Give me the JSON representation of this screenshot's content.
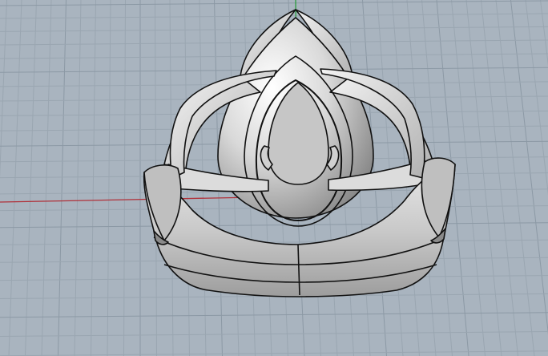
{
  "viewport": {
    "background": "#a9b4bf",
    "grid_minor_color": "#9aa6b1",
    "grid_major_color": "#8c99a5",
    "x_axis_color": "#b0313a",
    "y_axis_color": "#2a9b3e",
    "model_fill": "#d3d3d3",
    "model_stroke": "#111111",
    "model_name": "ring-model"
  }
}
